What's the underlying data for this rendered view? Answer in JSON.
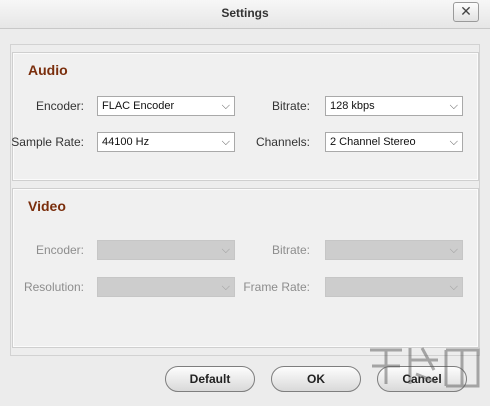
{
  "window": {
    "title": "Settings",
    "close_glyph": "✕"
  },
  "audio": {
    "heading": "Audio",
    "encoder": {
      "label": "Encoder:",
      "value": "FLAC Encoder"
    },
    "bitrate": {
      "label": "Bitrate:",
      "value": "128 kbps"
    },
    "sample_rate": {
      "label": "Sample Rate:",
      "value": "44100 Hz"
    },
    "channels": {
      "label": "Channels:",
      "value": "2 Channel Stereo"
    }
  },
  "video": {
    "heading": "Video",
    "encoder": {
      "label": "Encoder:",
      "value": ""
    },
    "bitrate": {
      "label": "Bitrate:",
      "value": ""
    },
    "resolution": {
      "label": "Resolution:",
      "value": ""
    },
    "frame_rate": {
      "label": "Frame Rate:",
      "value": ""
    }
  },
  "buttons": {
    "default": "Default",
    "ok": "OK",
    "cancel": "Cancel"
  },
  "colors": {
    "heading": "#7a2e0c",
    "disabled_field": "#cdcdcd"
  },
  "icons": {
    "dropdown": "chevron-down-icon"
  }
}
